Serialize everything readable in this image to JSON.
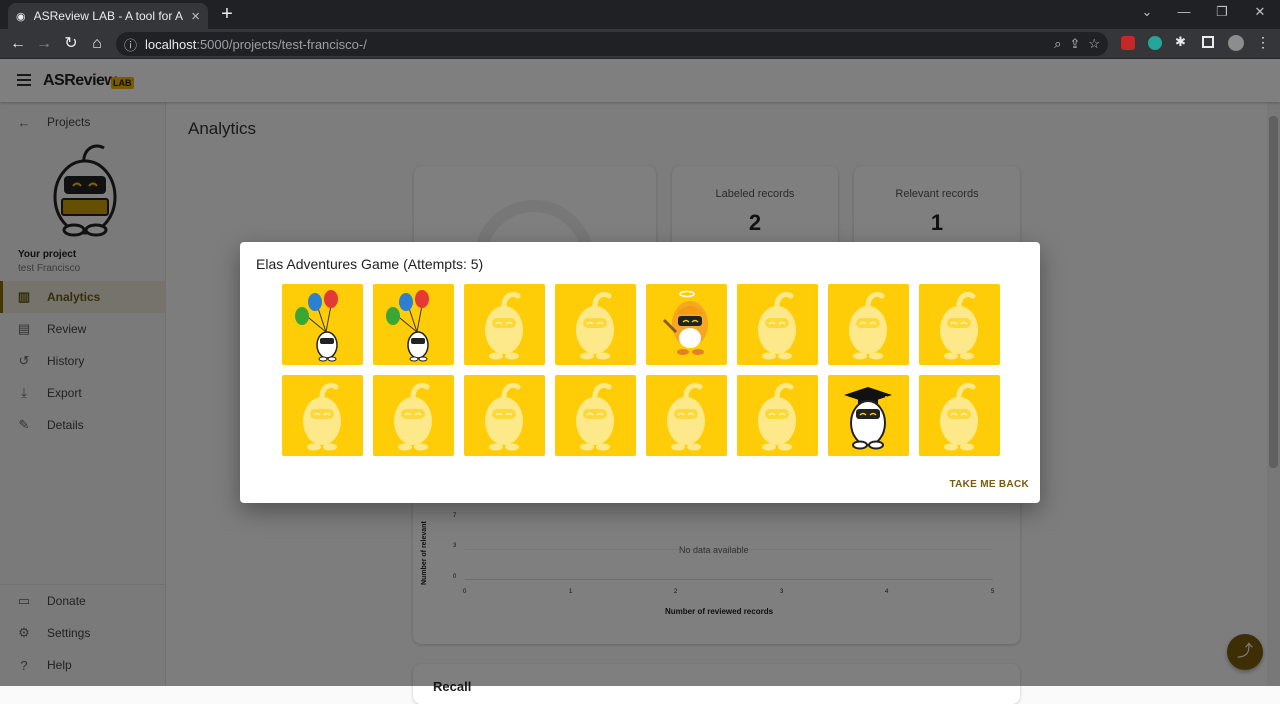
{
  "browser": {
    "tab_title": "ASReview LAB - A tool for AI-assisted",
    "url_host": "localhost",
    "url_rest": ":5000/projects/test-francisco-/"
  },
  "app": {
    "logo_text": "ASReview",
    "logo_badge": "LAB"
  },
  "sidebar": {
    "back_label": "Projects",
    "project_heading": "Your project",
    "project_name": "test Francisco",
    "items": [
      {
        "label": "Analytics",
        "icon": "bar-chart-icon"
      },
      {
        "label": "Review",
        "icon": "clipboard-icon"
      },
      {
        "label": "History",
        "icon": "history-icon"
      },
      {
        "label": "Export",
        "icon": "download-icon"
      },
      {
        "label": "Details",
        "icon": "pencil-icon"
      }
    ],
    "bottom_items": [
      {
        "label": "Donate",
        "icon": "credit-card-icon"
      },
      {
        "label": "Settings",
        "icon": "gear-icon"
      },
      {
        "label": "Help",
        "icon": "help-icon"
      }
    ]
  },
  "main": {
    "page_title": "Analytics",
    "stats": [
      {
        "label": "Labeled records",
        "value": "2"
      },
      {
        "label": "Relevant records",
        "value": "1"
      }
    ],
    "chart": {
      "ylabel": "Number of relevant",
      "xlabel": "Number of reviewed records",
      "yticks": [
        "7",
        "3",
        "0"
      ],
      "xticks": [
        "0",
        "1",
        "2",
        "3",
        "4",
        "5"
      ],
      "empty_text": "No data available"
    },
    "next_section": "Recall"
  },
  "dialog": {
    "title": "Elas Adventures Game (Attempts: 5)",
    "tiles": [
      "balloons",
      "balloons",
      "hidden",
      "hidden",
      "painter",
      "hidden",
      "hidden",
      "hidden",
      "hidden",
      "hidden",
      "hidden",
      "hidden",
      "hidden",
      "hidden",
      "graduate",
      "hidden"
    ],
    "button": "TAKE ME BACK"
  },
  "colors": {
    "tile": "#fecd07",
    "accent": "#7a5c0c"
  }
}
